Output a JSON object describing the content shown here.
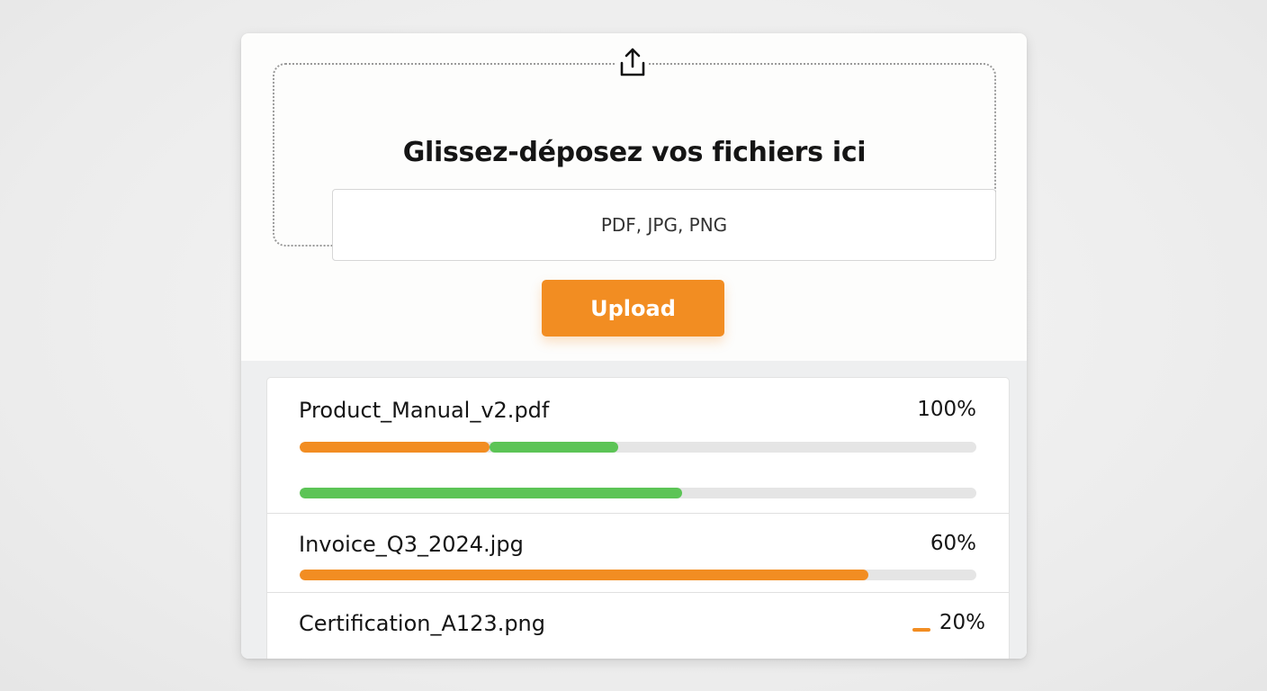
{
  "dropzone": {
    "icon": "upload-icon",
    "title": "Glissez-déposez vos fichiers ici",
    "accepted_types": "PDF, JPG, PNG"
  },
  "upload_button": {
    "label": "Upload",
    "color": "#f28d22"
  },
  "files": [
    {
      "name": "Product_Manual_v2.pdf",
      "percent_label": "100%",
      "bars": [
        {
          "segments": [
            {
              "color": "#f28d22",
              "fraction": 0.28
            },
            {
              "color": "#5cc456",
              "fraction": 0.19
            }
          ]
        },
        {
          "segments": [
            {
              "color": "#5cc456",
              "fraction": 0.565
            }
          ]
        }
      ]
    },
    {
      "name": "Invoice_Q3_2024.jpg",
      "percent_label": "60%",
      "bars": [
        {
          "segments": [
            {
              "color": "#f28d22",
              "fraction": 0.84
            }
          ]
        }
      ]
    },
    {
      "name": "Certification_A123.png",
      "percent_label": "20%",
      "indicator_color": "#f28d22"
    }
  ]
}
